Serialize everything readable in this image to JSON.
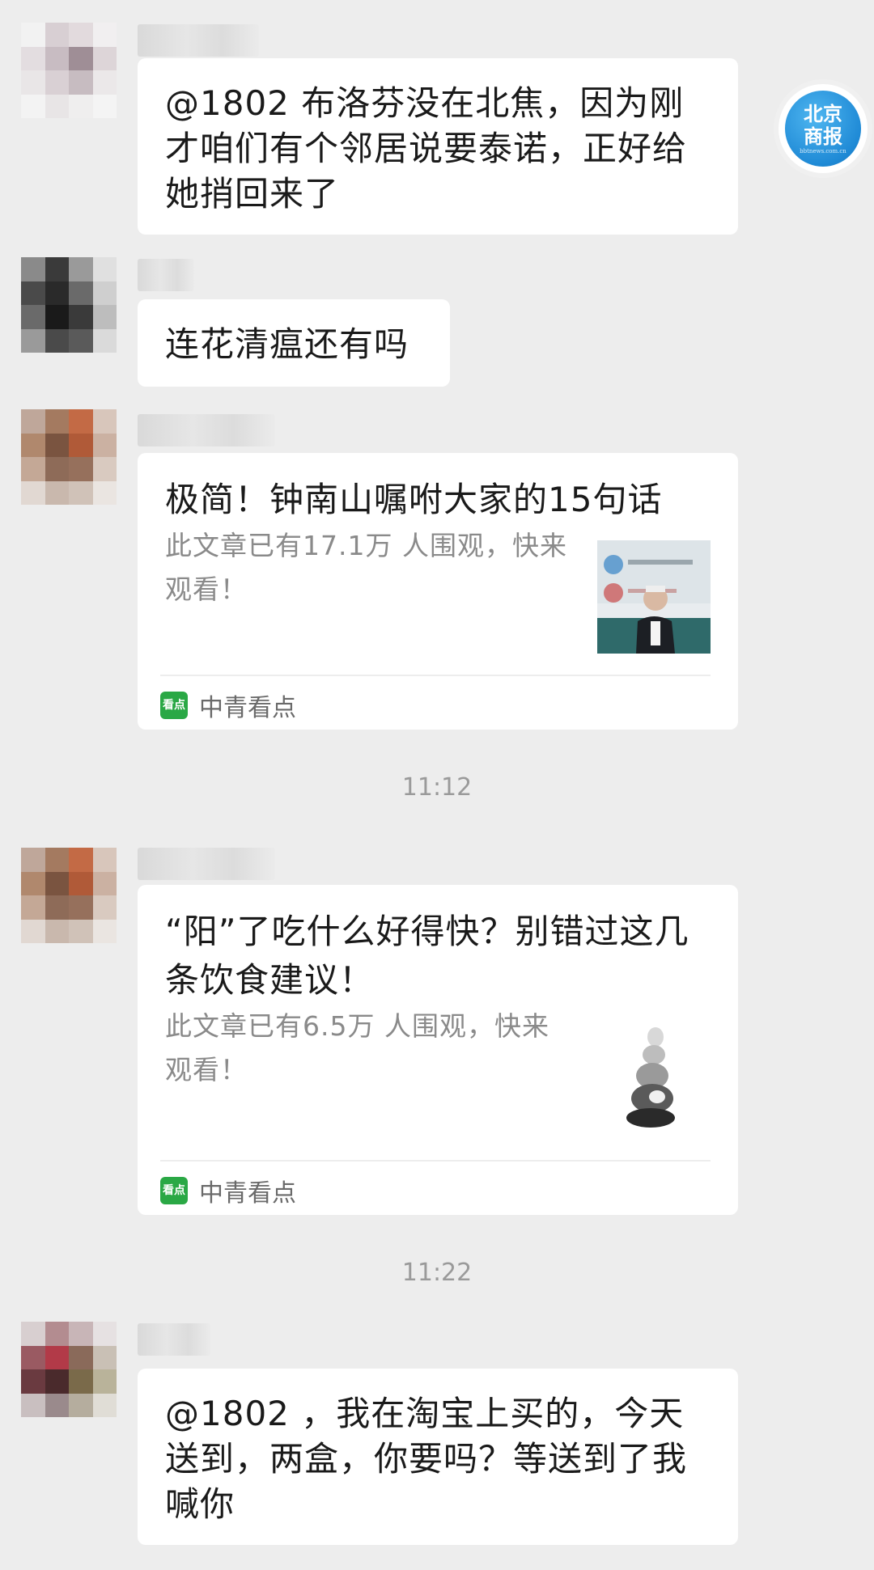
{
  "watermark": {
    "line1": "北京",
    "line2": "商报",
    "url": "bbtnews.com.cn"
  },
  "messages": [
    {
      "type": "text",
      "text": "@1802  布洛芬没在北焦，因为刚才咱们有个邻居说要泰诺，正好给她捎回来了"
    },
    {
      "type": "text",
      "text": "连花清瘟还有吗"
    },
    {
      "type": "card",
      "title": "极简！钟南山嘱咐大家的15句话",
      "desc": "此文章已有17.1万 人围观，快来观看！",
      "source": "中青看点",
      "source_icon": "看点"
    },
    {
      "type": "card",
      "title": "“阳”了吃什么好得快？别错过这几条饮食建议！",
      "desc": "此文章已有6.5万 人围观，快来观看！",
      "source": "中青看点",
      "source_icon": "看点"
    },
    {
      "type": "text",
      "text": "@1802 ，我在淘宝上买的，今天送到，两盒，你要吗？等送到了我喊你"
    }
  ],
  "timestamps": [
    "11:12",
    "11:22"
  ],
  "colors": {
    "background": "#ededed",
    "bubble": "#ffffff",
    "source_icon": "#2aa845",
    "logo_blue": "#1f8ad6"
  }
}
